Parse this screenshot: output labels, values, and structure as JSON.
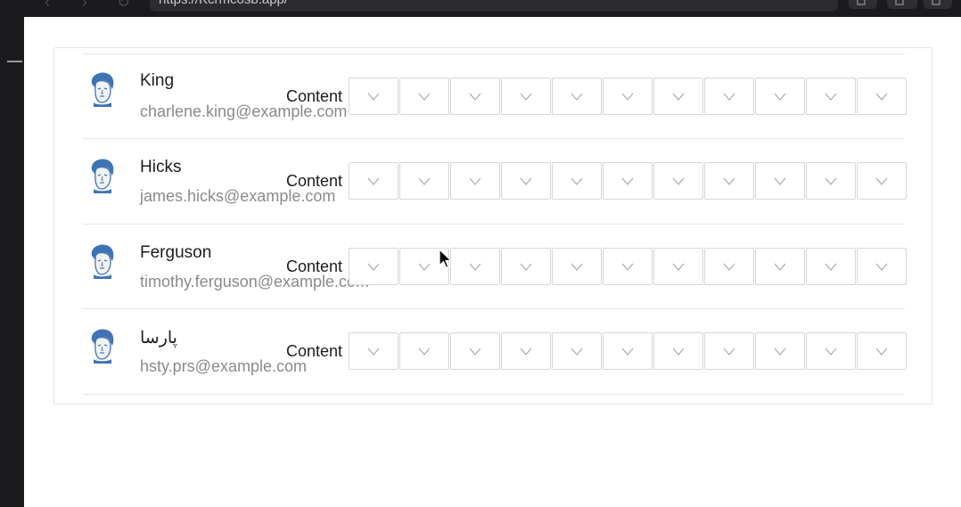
{
  "browser": {
    "address": "https://Kcrmcosb.app/",
    "back_icon": "chevron-left-icon",
    "forward_icon": "chevron-right-icon",
    "reload_icon": "reload-icon"
  },
  "users": [
    {
      "name": "King",
      "email": "charlene.king@example.com",
      "content_label": "Content"
    },
    {
      "name": "Hicks",
      "email": "james.hicks@example.com",
      "content_label": "Content"
    },
    {
      "name": "Ferguson",
      "email": "timothy.ferguson@example.com",
      "content_label": "Content"
    },
    {
      "name": "پارسا",
      "email": "hsty.prs@example.com",
      "content_label": "Content"
    }
  ],
  "dropdowns_per_row": 11,
  "dropdown_icon": "chevron-down-icon",
  "colors": {
    "page_bg": "#ffffff",
    "chrome_bg": "#1b1b1d",
    "border": "#d6d6d6",
    "name": "#1d1d1d",
    "email": "#8a8a8a",
    "avatar_blue": "#3f74b4"
  }
}
